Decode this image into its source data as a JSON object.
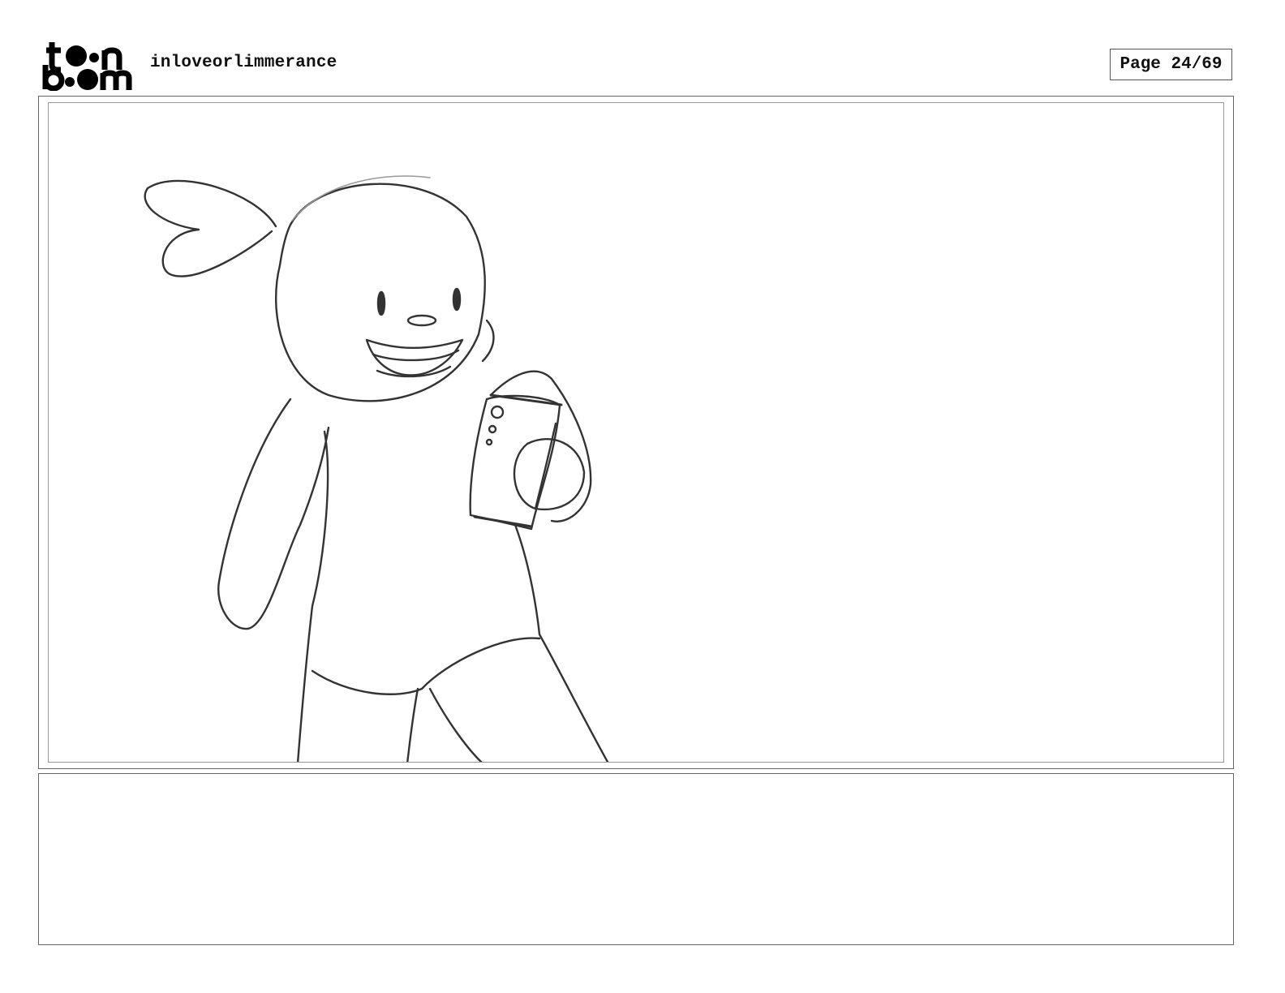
{
  "header": {
    "logo_text": "toon boom",
    "project_name": "inloveorlimmerance",
    "page_label": "Page 24/69"
  },
  "panel": {
    "sketch_subject": "character-holding-phone"
  },
  "notes": {
    "text": ""
  }
}
